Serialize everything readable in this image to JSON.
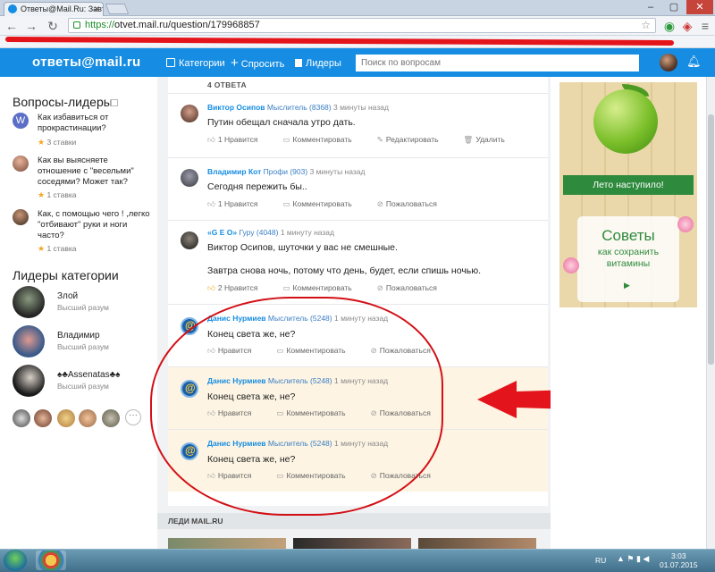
{
  "browser": {
    "tab_title": "Ответы@Mail.Ru: Завтр",
    "url_scheme": "https://",
    "url_rest": "otvet.mail.ru/question/179968857"
  },
  "header": {
    "logo_text": "ответы@mail.ru",
    "nav_categories": "Категории",
    "nav_ask": "Спросить",
    "nav_leaders": "Лидеры",
    "search_placeholder": "Поиск по вопросам"
  },
  "left": {
    "leaders_questions_title": "Вопросы-лидеры",
    "questions": [
      {
        "text": "Как избавиться от прокрастинации?",
        "meta": "3 ставки",
        "avatar_letter": "W"
      },
      {
        "text": "Как вы выясняете отношение с \"весельми\" соседями? Может так?",
        "meta": "1 ставка"
      },
      {
        "text": "Как, с помощью чего ! ,легко \"отбивают\" руки и ноги часто?",
        "meta": "1 ставка"
      }
    ],
    "category_leaders_title": "Лидеры категории",
    "leaders": [
      {
        "name": "Злой",
        "rank": "Высший разум"
      },
      {
        "name": "Владимир",
        "rank": "Высший разум"
      },
      {
        "name": "♠♣Assenatas♣♠",
        "rank": "Высший разум"
      }
    ],
    "more": "···"
  },
  "answers": {
    "count_label": "4 ОТВЕТА",
    "items": [
      {
        "author": "Виктор Осипов",
        "rank": "Мыслитель (8368)",
        "time": "3 минуты назад",
        "text": "Путин обещал сначала утро дать.",
        "text2": "",
        "likes": "1 Нравится",
        "comment": "Комментировать",
        "a3": "Редактировать",
        "a4": "Удалить"
      },
      {
        "author": "Владимир Кот",
        "rank": "Профи (903)",
        "time": "3 минуты назад",
        "text": "Сегодня пережить бы..",
        "text2": "",
        "likes": "1 Нравится",
        "comment": "Комментировать",
        "a3": "Пожаловаться",
        "a4": ""
      },
      {
        "author": "«G E O»",
        "rank": "Гуру (4048)",
        "time": "1 минуту назад",
        "text": "Виктор Осипов, шуточки у вас не смешные.",
        "text2": "Завтра снова ночь, потому что день, будет, если спишь ночью.",
        "likes": "2 Нравится",
        "comment": "Комментировать",
        "a3": "Пожаловаться",
        "a4": ""
      },
      {
        "author": "Данис Нурмиев",
        "rank": "Мыслитель (5248)",
        "time": "1 минуту назад",
        "text": "Конец света же, не?",
        "text2": "",
        "likes": "Нравится",
        "comment": "Комментировать",
        "a3": "Пожаловаться",
        "a4": ""
      },
      {
        "author": "Данис Нурмиев",
        "rank": "Мыслитель (5248)",
        "time": "1 минуту назад",
        "text": "Конец света же, не?",
        "text2": "",
        "likes": "Нравится",
        "comment": "Комментировать",
        "a3": "Пожаловаться",
        "a4": ""
      },
      {
        "author": "Данис Нурмиев",
        "rank": "Мыслитель (5248)",
        "time": "1 минуту назад",
        "text": "Конец света же, не?",
        "text2": "",
        "likes": "Нравится",
        "comment": "Комментировать",
        "a3": "Пожаловаться",
        "a4": ""
      }
    ]
  },
  "ladies": {
    "label": "ЛЕДИ MAIL.RU"
  },
  "ad": {
    "banner": "Лето наступило!",
    "title": "Советы",
    "subtitle_1": "как сохранить",
    "subtitle_2": "витамины"
  },
  "taskbar": {
    "lang": "RU",
    "time": "3:03",
    "date": "01.07.2015"
  },
  "colors": {
    "brand": "#168de2",
    "annotation": "#d21016",
    "highlight": "#fdf4e3"
  }
}
